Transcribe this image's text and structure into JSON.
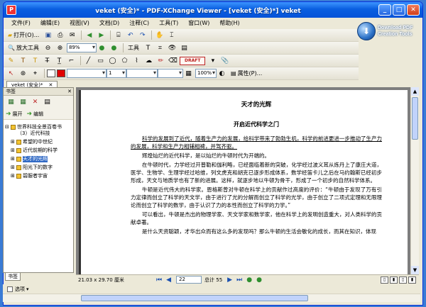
{
  "window": {
    "title": "veket (安全)* - PDF-XChange Viewer - [veket (安全)*] veket",
    "minimize": "_",
    "maximize": "□",
    "close": "✕",
    "app_icon": "P"
  },
  "menu": [
    "文件(F)",
    "编辑(E)",
    "视图(V)",
    "文档(D)",
    "注释(C)",
    "工具(T)",
    "窗口(W)",
    "帮助(H)"
  ],
  "brand": {
    "line1": "Download PDF",
    "line2": "Creation Tools",
    "icon": "globe-download-icon"
  },
  "toolbar1": {
    "open_label": "打开(O)...",
    "icons": [
      "save-icon",
      "print-icon",
      "email-icon",
      "back-icon",
      "forward-icon",
      "scan-icon",
      "undo-icon",
      "redo-icon",
      "hand-icon",
      "select-icon"
    ]
  },
  "toolbar2": {
    "zoom_label": "放大工具",
    "zoom_value": "89%",
    "tools_label": "工具"
  },
  "toolbar3": {
    "draft_stamp": "DRAFT"
  },
  "toolbar4": {
    "line_width": "1",
    "opacity": "100%",
    "properties_label": "属性(P)...",
    "fill_color": "#e00000"
  },
  "doc_tab": {
    "label": "veket (安全)*"
  },
  "bookmarks": {
    "pane_title": "书签",
    "expand_label": "展开",
    "edit_label": "编辑",
    "items": [
      {
        "label": "世界科技全景百卷书（3）近代科技",
        "level": 0,
        "toggle": "⊟"
      },
      {
        "label": "希望的中世纪",
        "level": 1,
        "toggle": "⊞"
      },
      {
        "label": "近代前期的科学",
        "level": 1,
        "toggle": "⊞"
      },
      {
        "label": "天才的光辉",
        "level": 1,
        "toggle": "⊞",
        "selected": true
      },
      {
        "label": "阳光下的数字",
        "level": 1,
        "toggle": "⊞"
      },
      {
        "label": "碧服者宇宙",
        "level": 1,
        "toggle": "⊞"
      }
    ],
    "bottom_tab": "书签"
  },
  "document": {
    "title": "天才的光辉",
    "subtitle": "开启近代科学之门",
    "paragraphs": [
      "科学的发展到了近代，随着生产力的发展，给科学带来了勃勃生机，科学的前进更进一步推动了生产力的发展，科学和生产力相辅相裨，并驾齐驱。",
      "辉煌灿烂的近代科学，是以灿烂的牛顿时代为开端的。",
      "在牛顿时代，力学经过开普勒和伽利略，已经面临着新的突破，化学经过波义耳从炼丹上了康庄大道，医学、生物学、生理学经过哈维，列文虎克和胡克已逐步形成体系，数学经笛卡儿之后在马约翰斯已经初步形成，天文与地质学也有了新的进展。这样，就逐步地以牛顿为骨干，形成了一个初步的自然科学体系。",
      "牛顿是近代伟大的科学家。恩格斯曾对牛顿在科学上的贡献作过高度的评价：“牛顿由于发现了万有引力定律而创立了科学的天文学，由于进行了光的分解而创立了科学的光学，由于创立了二项式定理和无限理论而创立了科学的数学，由于认识了力的本性而创立了科学的力学。”",
      "可以看出，牛顿是杰出的物理学家、天文学家和数学家，他在科学上的发明创造重大，对人类科学的贡献卓著。",
      "是什么天资聪颖，才华出众而有这么多的发现吗？那么牛顿的生活会敏化的成长，而其在知识，体现"
    ]
  },
  "status": {
    "page_size": "21.03 x 29.70 厘米",
    "current_page": "22",
    "total_pages": "总计 55",
    "options_label": "选项"
  }
}
